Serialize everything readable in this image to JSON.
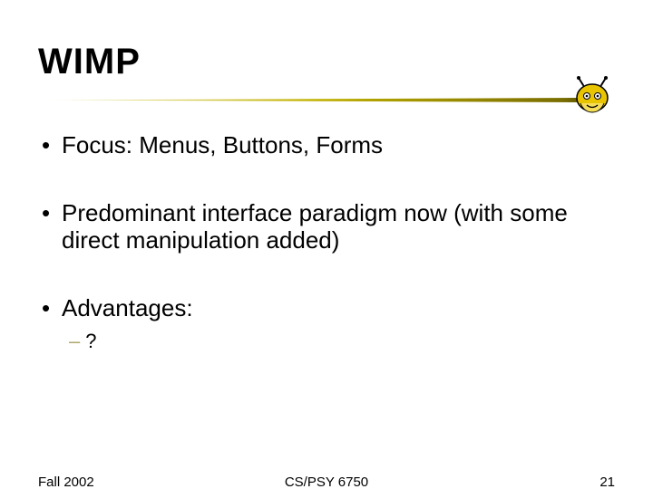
{
  "title": "WIMP",
  "bullets": [
    {
      "text": "Focus: Menus, Buttons, Forms"
    },
    {
      "text": "Predominant interface paradigm now (with some direct manipulation added)"
    },
    {
      "text": "Advantages:",
      "sub": [
        {
          "dash": "–",
          "text": "?"
        }
      ]
    }
  ],
  "footer": {
    "left": "Fall 2002",
    "center": "CS/PSY 6750",
    "right": "21"
  },
  "colors": {
    "accent": "#b8a900",
    "dash": "#aca76a"
  }
}
